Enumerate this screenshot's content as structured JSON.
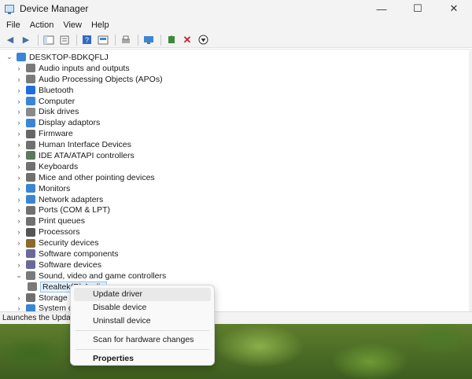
{
  "window": {
    "title": "Device Manager",
    "minimize": "—",
    "maximize": "☐",
    "close": "✕"
  },
  "menu": [
    "File",
    "Action",
    "View",
    "Help"
  ],
  "tree": {
    "root": "DESKTOP-BDKQFLJ",
    "categories": [
      {
        "label": "Audio inputs and outputs",
        "icon": "speaker-icon",
        "color": "#7a7a7a"
      },
      {
        "label": "Audio Processing Objects (APOs)",
        "icon": "speaker-icon",
        "color": "#7a7a7a"
      },
      {
        "label": "Bluetooth",
        "icon": "bluetooth-icon",
        "color": "#1e6fd9"
      },
      {
        "label": "Computer",
        "icon": "computer-icon",
        "color": "#3a86d4"
      },
      {
        "label": "Disk drives",
        "icon": "disk-icon",
        "color": "#8a8a8a"
      },
      {
        "label": "Display adaptors",
        "icon": "display-icon",
        "color": "#3a86d4"
      },
      {
        "label": "Firmware",
        "icon": "firmware-icon",
        "color": "#666666"
      },
      {
        "label": "Human Interface Devices",
        "icon": "hid-icon",
        "color": "#707070"
      },
      {
        "label": "IDE ATA/ATAPI controllers",
        "icon": "ide-icon",
        "color": "#5a7a5a"
      },
      {
        "label": "Keyboards",
        "icon": "keyboard-icon",
        "color": "#707070"
      },
      {
        "label": "Mice and other pointing devices",
        "icon": "mouse-icon",
        "color": "#707070"
      },
      {
        "label": "Monitors",
        "icon": "monitor-icon",
        "color": "#3a86d4"
      },
      {
        "label": "Network adapters",
        "icon": "network-icon",
        "color": "#3a86d4"
      },
      {
        "label": "Ports (COM & LPT)",
        "icon": "port-icon",
        "color": "#707070"
      },
      {
        "label": "Print queues",
        "icon": "printer-icon",
        "color": "#707070"
      },
      {
        "label": "Processors",
        "icon": "processor-icon",
        "color": "#555555"
      },
      {
        "label": "Security devices",
        "icon": "security-icon",
        "color": "#8a6a2a"
      },
      {
        "label": "Software components",
        "icon": "software-icon",
        "color": "#6a6a9a"
      },
      {
        "label": "Software devices",
        "icon": "software-icon",
        "color": "#6a6a9a"
      },
      {
        "label": "Sound, video and game controllers",
        "icon": "sound-icon",
        "color": "#7a7a7a"
      }
    ],
    "selected_child": "Realtek(R) Audio",
    "after": [
      {
        "label": "Storage c",
        "icon": "storage-icon",
        "color": "#707070"
      },
      {
        "label": "System de",
        "icon": "system-icon",
        "color": "#3a86d4"
      }
    ]
  },
  "status": "Launches the Update",
  "context_menu": {
    "update": "Update driver",
    "disable": "Disable device",
    "uninstall": "Uninstall device",
    "scan": "Scan for hardware changes",
    "properties": "Properties"
  }
}
